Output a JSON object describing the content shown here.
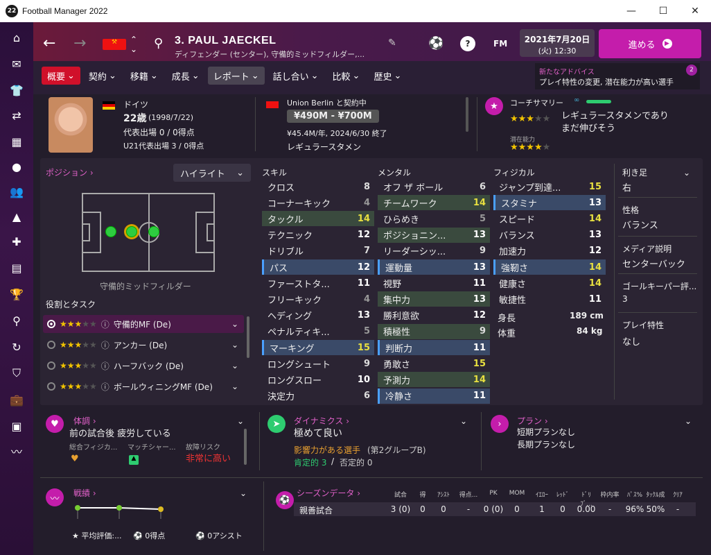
{
  "app": {
    "title": "Football Manager 2022",
    "badge": "22"
  },
  "header": {
    "player_name": "3. PAUL JAECKEL",
    "position_text": "ディフェンダー (センター), 守備的ミッドフィルダー,...",
    "date": "2021年7月20日",
    "day_time": "(火) 12:30",
    "continue_label": "進める",
    "fm_label": "FM"
  },
  "tabs": [
    {
      "label": "概要",
      "active": true
    },
    {
      "label": "契約"
    },
    {
      "label": "移籍"
    },
    {
      "label": "成長"
    },
    {
      "label": "レポート",
      "hl": true
    },
    {
      "label": "話し合い"
    },
    {
      "label": "比較"
    },
    {
      "label": "歴史"
    }
  ],
  "advice": {
    "title": "新たなアドバイス",
    "text": "プレイ特性の変更, 潜在能力が高い選手",
    "count": "2"
  },
  "profile": {
    "nation": "ドイツ",
    "age": "22歳",
    "dob": "(1998/7/22)",
    "caps": "代表出場 0 / 0得点",
    "u21": "U21代表出場 3 / 0得点",
    "club_contract": "Union Berlin と契約中",
    "value": "¥490M - ¥700M",
    "wage": "¥45.4M/年, 2024/6/30 終了",
    "status": "レギュラースタメン",
    "coach_label": "コーチサマリー",
    "coach_text1": "レギュラースタメンであり",
    "coach_text2": "まだ伸びそう",
    "potential_label": "潜在能力"
  },
  "position": {
    "title": "ポジション",
    "highlight": "ハイライト",
    "role_name": "守備的ミッドフィルダー",
    "roles_title": "役割とタスク",
    "roles": [
      {
        "label": "守備的MF (De)"
      },
      {
        "label": "アンカー (De)"
      },
      {
        "label": "ハーフバック (De)"
      },
      {
        "label": "ボールウィニングMF (De)"
      }
    ]
  },
  "skills": {
    "title": "スキル",
    "items": [
      {
        "name": "クロス",
        "val": "8"
      },
      {
        "name": "コーナーキック",
        "val": "4"
      },
      {
        "name": "タックル",
        "val": "14"
      },
      {
        "name": "テクニック",
        "val": "12"
      },
      {
        "name": "ドリブル",
        "val": "7"
      },
      {
        "name": "パス",
        "val": "12"
      },
      {
        "name": "ファーストタ...",
        "val": "11"
      },
      {
        "name": "フリーキック",
        "val": "4"
      },
      {
        "name": "ヘディング",
        "val": "13"
      },
      {
        "name": "ペナルティキ...",
        "val": "5"
      },
      {
        "name": "マーキング",
        "val": "15"
      },
      {
        "name": "ロングシュート",
        "val": "9"
      },
      {
        "name": "ロングスロー",
        "val": "10"
      },
      {
        "name": "決定力",
        "val": "6"
      }
    ]
  },
  "mental": {
    "title": "メンタル",
    "items": [
      {
        "name": "オフ ザ ボール",
        "val": "6"
      },
      {
        "name": "チームワーク",
        "val": "14"
      },
      {
        "name": "ひらめき",
        "val": "5"
      },
      {
        "name": "ポジショニン...",
        "val": "13"
      },
      {
        "name": "リーダーシッ...",
        "val": "9"
      },
      {
        "name": "運動量",
        "val": "13"
      },
      {
        "name": "視野",
        "val": "11"
      },
      {
        "name": "集中力",
        "val": "13"
      },
      {
        "name": "勝利意欲",
        "val": "12"
      },
      {
        "name": "積極性",
        "val": "9"
      },
      {
        "name": "判断力",
        "val": "11"
      },
      {
        "name": "勇敢さ",
        "val": "15"
      },
      {
        "name": "予測力",
        "val": "14"
      },
      {
        "name": "冷静さ",
        "val": "11"
      }
    ]
  },
  "physical": {
    "title": "フィジカル",
    "items": [
      {
        "name": "ジャンプ到達...",
        "val": "15"
      },
      {
        "name": "スタミナ",
        "val": "13"
      },
      {
        "name": "スピード",
        "val": "14"
      },
      {
        "name": "バランス",
        "val": "13"
      },
      {
        "name": "加速力",
        "val": "12"
      },
      {
        "name": "強靭さ",
        "val": "14"
      },
      {
        "name": "健康さ",
        "val": "14"
      },
      {
        "name": "敏捷性",
        "val": "11"
      }
    ],
    "height_label": "身長",
    "height": "189 cm",
    "weight_label": "体重",
    "weight": "84 kg"
  },
  "info": {
    "foot_label": "利き足",
    "foot": "右",
    "pers_label": "性格",
    "pers": "バランス",
    "media_label": "メディア説明",
    "media": "センターバック",
    "gk_label": "ゴールキーパー評...",
    "gk": "3",
    "traits_label": "プレイ特性",
    "traits": "なし"
  },
  "condition": {
    "title": "体調",
    "text": "前の試合後 疲労している",
    "c1": "総合フィジカ...",
    "c2": "マッチシャー...",
    "c3": "故障リスク",
    "risk": "非常に高い"
  },
  "dynamics": {
    "title": "ダイナミクス",
    "text": "極めて良い",
    "influence": "影響力がある選手",
    "group": "(第2グループB)",
    "pos": "肯定的 3",
    "sep": "/",
    "neg": "否定的 0"
  },
  "plans": {
    "title": "プラン",
    "short": "短期プランなし",
    "long": "長期プランなし"
  },
  "form": {
    "title": "戦績",
    "avg": "平均評価:...",
    "goals": "0得点",
    "assists": "0アシスト"
  },
  "season": {
    "title": "シーズンデータ",
    "headers": [
      "試合",
      "得",
      "ｱｼｽﾄ",
      "得点...",
      "PK",
      "MOM",
      "ｲｴﾛｰ",
      "ﾚｯﾄﾞ",
      "ﾄﾞﾘﾌﾞ...",
      "枠内率",
      "ﾊﾟｽ%",
      "ﾀｯｸﾙ成",
      "ｸﾘｱ"
    ],
    "row_label": "親善試合",
    "values": [
      "3 (0)",
      "0",
      "0",
      "-",
      "0 (0)",
      "0",
      "1",
      "0",
      "0.00",
      "-",
      "96%",
      "50%",
      "-"
    ]
  },
  "colors": {
    "accent": "#c41dab",
    "select_red": "#d0102a",
    "green": "#2ecc40"
  }
}
